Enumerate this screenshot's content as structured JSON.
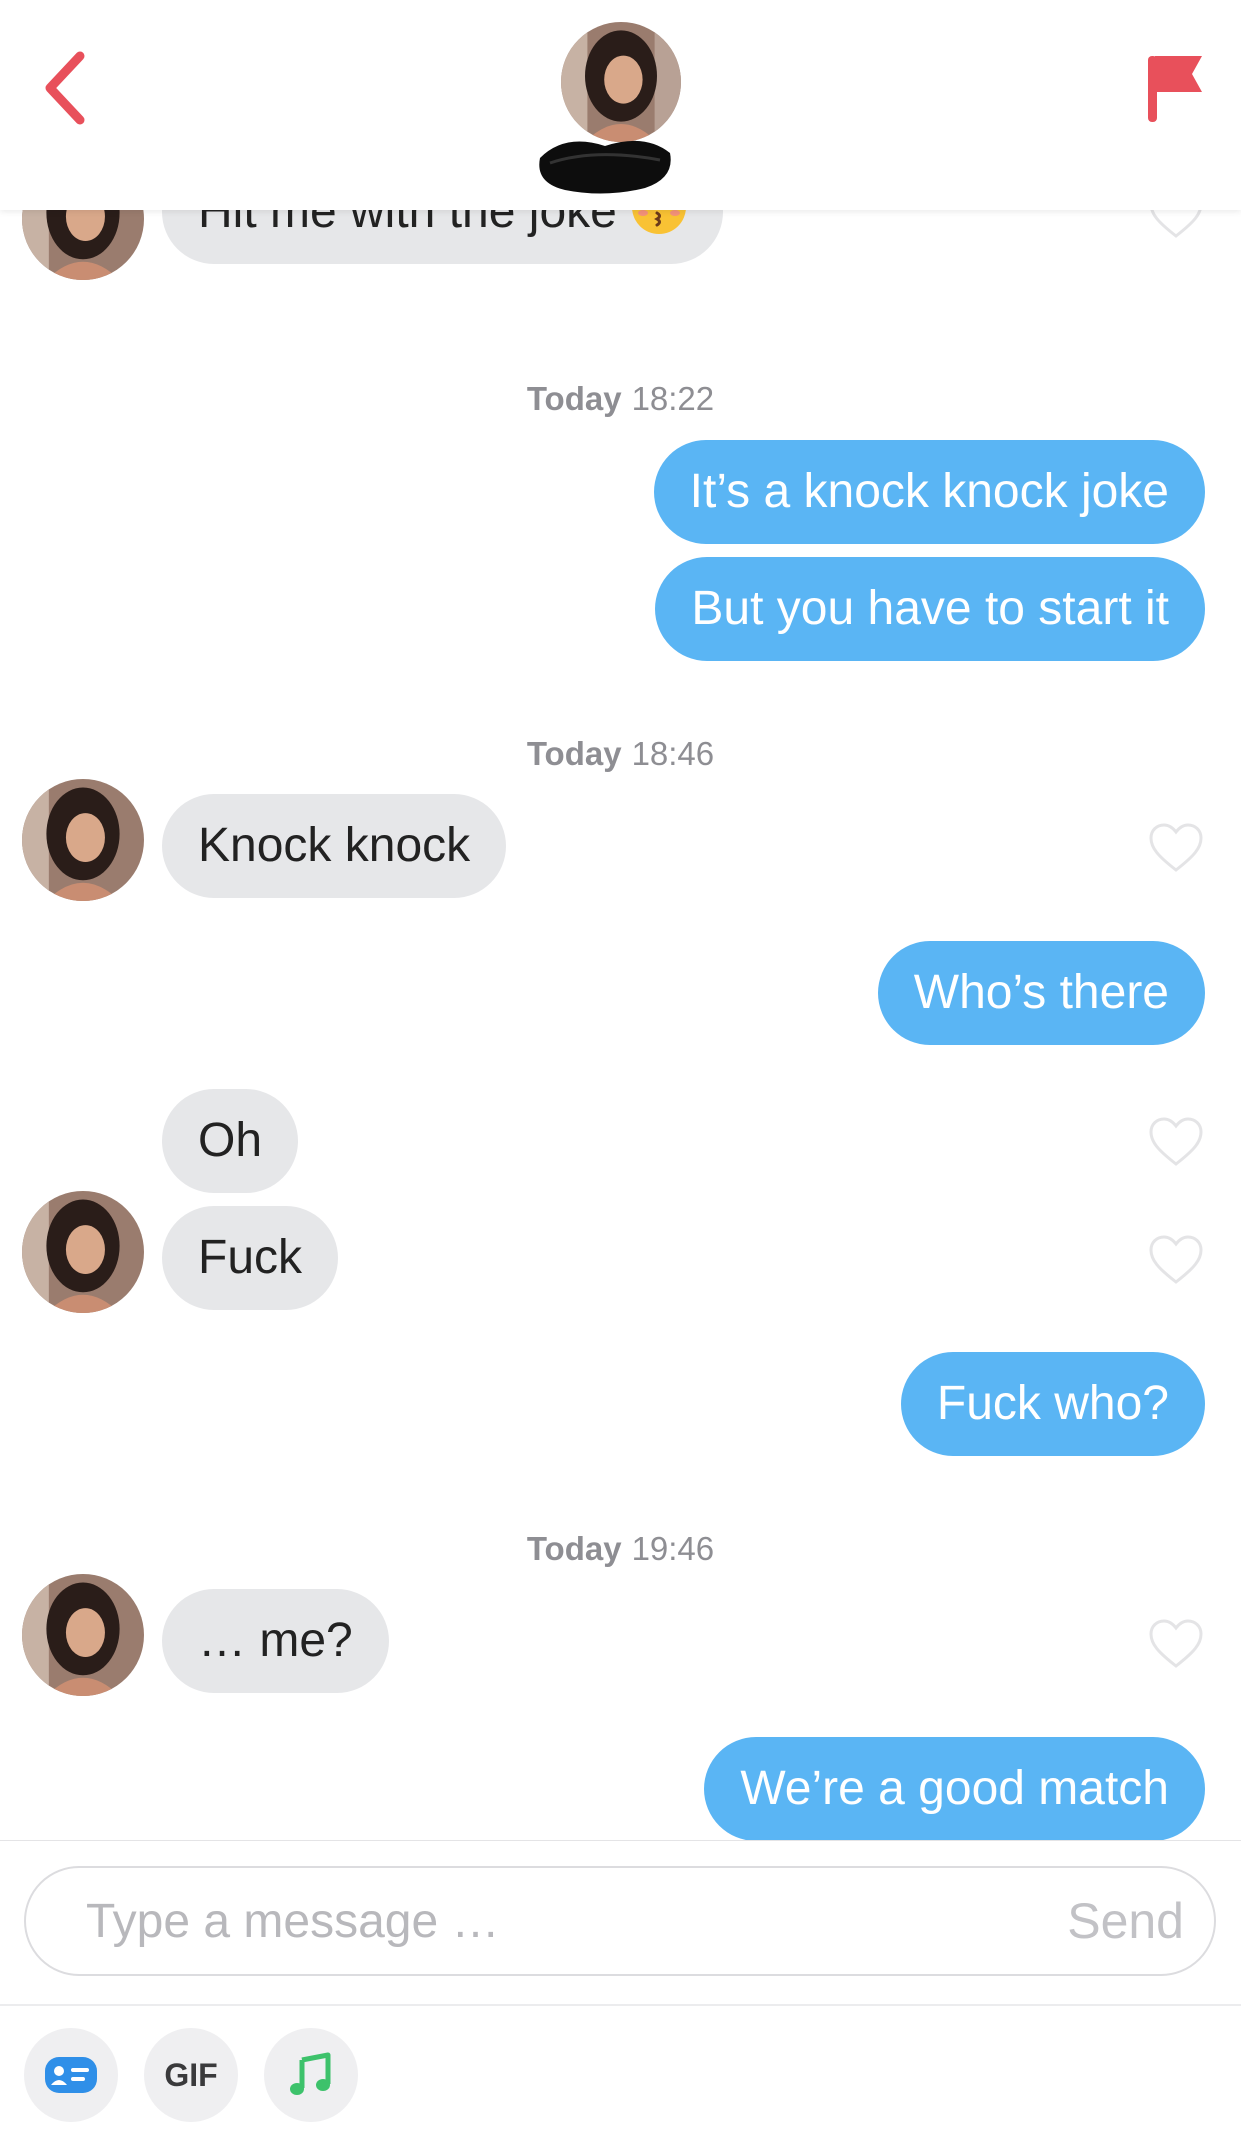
{
  "header": {
    "back_icon": "chevron-left-icon",
    "report_icon": "flag-icon",
    "accent_color": "#e8505b"
  },
  "messages": [
    {
      "direction": "incoming",
      "text": "Hit me with the joke",
      "emoji": "kissing-face-with-closed-eyes"
    },
    {
      "type": "timestamp",
      "day": "Today",
      "time": "18:22"
    },
    {
      "direction": "outgoing",
      "text": "It’s a knock knock joke"
    },
    {
      "direction": "outgoing",
      "text": "But you have to start it"
    },
    {
      "type": "timestamp",
      "day": "Today",
      "time": "18:46"
    },
    {
      "direction": "incoming",
      "text": "Knock knock"
    },
    {
      "direction": "outgoing",
      "text": "Who’s there"
    },
    {
      "direction": "incoming",
      "text": "Oh"
    },
    {
      "direction": "incoming",
      "text": "Fuck"
    },
    {
      "direction": "outgoing",
      "text": "Fuck who?"
    },
    {
      "type": "timestamp",
      "day": "Today",
      "time": "19:46"
    },
    {
      "direction": "incoming",
      "text": "… me?"
    },
    {
      "direction": "outgoing",
      "text": "We’re a good match"
    }
  ],
  "colors": {
    "outgoing_bubble": "#5ab5f4",
    "incoming_bubble": "#e6e7e9"
  },
  "composer": {
    "placeholder": "Type a message …",
    "send_label": "Send",
    "tools": [
      {
        "icon": "contact-card-icon"
      },
      {
        "label": "GIF"
      },
      {
        "icon": "music-note-icon"
      }
    ]
  }
}
